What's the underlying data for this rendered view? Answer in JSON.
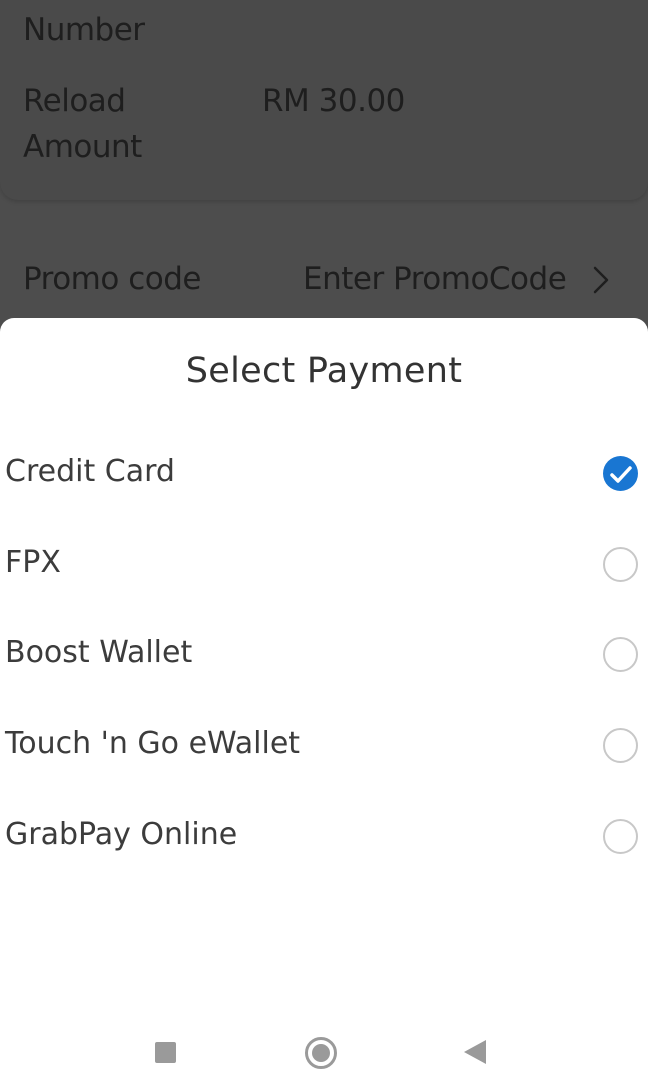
{
  "background": {
    "number_label": "Number",
    "reload_label_line1": "Reload",
    "reload_label_line2": "Amount",
    "reload_value": "RM 30.00",
    "promo_label": "Promo code",
    "promo_value": "Enter PromoCode",
    "promo_chevron_icon": "chevron-right-icon"
  },
  "sheet": {
    "title": "Select Payment",
    "options": [
      {
        "label": "Credit Card",
        "selected": true
      },
      {
        "label": "FPX",
        "selected": false
      },
      {
        "label": "Boost Wallet",
        "selected": false
      },
      {
        "label": "Touch 'n Go eWallet",
        "selected": false
      },
      {
        "label": "GrabPay Online",
        "selected": false
      }
    ]
  },
  "nav": {
    "recents_icon": "square-icon",
    "home_icon": "circle-icon",
    "back_icon": "triangle-back-icon"
  },
  "colors": {
    "accent": "#1976d2",
    "overlay": "#4d4d4d",
    "radio_border": "#c8c8c8"
  }
}
